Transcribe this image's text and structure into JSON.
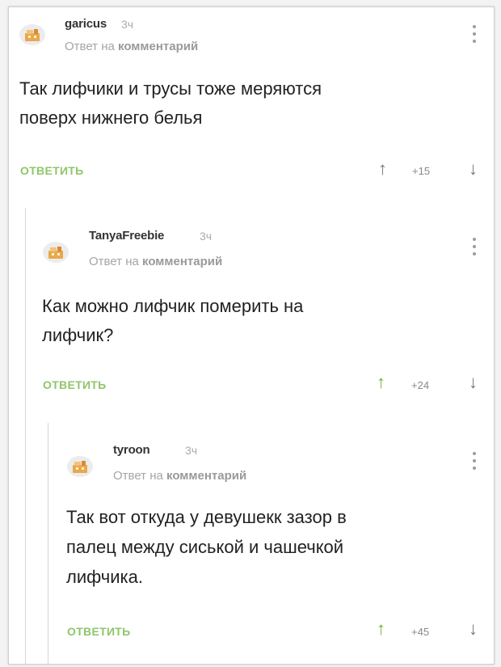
{
  "comments": [
    {
      "username": "garicus",
      "time": "3ч",
      "reply_prefix": "Ответ на",
      "reply_target": "комментарий",
      "text_lines": [
        "Так лифчики и трусы тоже меряются",
        "поверх нижнего белья"
      ],
      "reply_label": "ОТВЕТИТЬ",
      "score": "+15",
      "upvote_color": "#777777"
    },
    {
      "username": "TanyaFreebie",
      "time": "3ч",
      "reply_prefix": "Ответ на",
      "reply_target": "комментарий",
      "text_lines": [
        "Как можно лифчик померить на",
        "лифчик?"
      ],
      "reply_label": "ОТВЕТИТЬ",
      "score": "+24",
      "upvote_color": "#6fb23b"
    },
    {
      "username": "tyroon",
      "time": "3ч",
      "reply_prefix": "Ответ на",
      "reply_target": "комментарий",
      "text_lines": [
        "Так вот откуда у девушекк зазор в",
        "палец между сиськой и чашечкой",
        "лифчика."
      ],
      "reply_label": "ОТВЕТИТЬ",
      "score": "+45",
      "upvote_color": "#6fb23b"
    }
  ],
  "icons": {
    "upvote": "upvote-arrow-icon",
    "downvote": "downvote-arrow-icon",
    "menu": "more-vertical-icon",
    "avatar": "default-avatar-icon"
  },
  "colors": {
    "reply_button": "#8fc56a",
    "upvote_active": "#6fb23b"
  }
}
